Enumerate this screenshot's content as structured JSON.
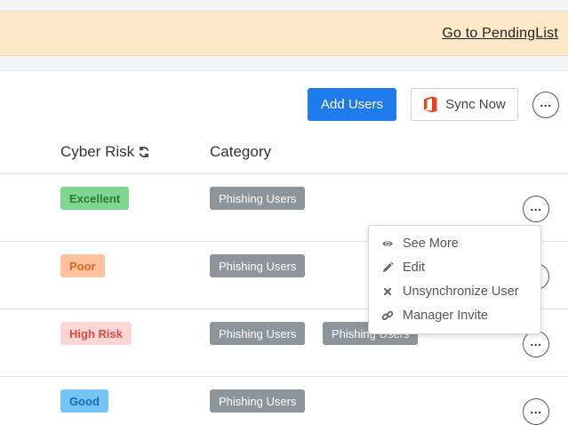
{
  "banner": {
    "link_label": "Go to PendingList"
  },
  "toolbar": {
    "add_users_label": "Add Users",
    "sync_now_label": "Sync Now",
    "sync_icon": "office-icon",
    "more_icon": "more-dots-icon"
  },
  "table": {
    "headers": {
      "cyber_risk": "Cyber Risk",
      "category": "Category"
    },
    "rows": [
      {
        "risk": "Excellent",
        "categories": [
          "Phishing Users"
        ]
      },
      {
        "risk": "Poor",
        "categories": [
          "Phishing Users"
        ]
      },
      {
        "risk": "High Risk",
        "categories": [
          "Phishing Users",
          "Phishing Users"
        ]
      },
      {
        "risk": "Good",
        "categories": [
          "Phishing Users"
        ]
      }
    ]
  },
  "context_menu": {
    "items": [
      {
        "label": "See More",
        "icon": "eye-icon"
      },
      {
        "label": "Edit",
        "icon": "pencil-icon"
      },
      {
        "label": "Unsynchronize User",
        "icon": "close-icon"
      },
      {
        "label": "Manager Invite",
        "icon": "link-icon"
      }
    ]
  },
  "colors": {
    "banner_bg": "#fde8c8",
    "primary": "#1f7aec",
    "category_bg": "#8d959c",
    "excellent_bg": "#7fd690",
    "excellent_fg": "#2c7a3a",
    "poor_bg": "#ffc19e",
    "poor_fg": "#e0651d",
    "high_risk_bg": "#fdd6d6",
    "high_risk_fg": "#e04848",
    "good_bg": "#74c4f6",
    "good_fg": "#1669b8"
  }
}
